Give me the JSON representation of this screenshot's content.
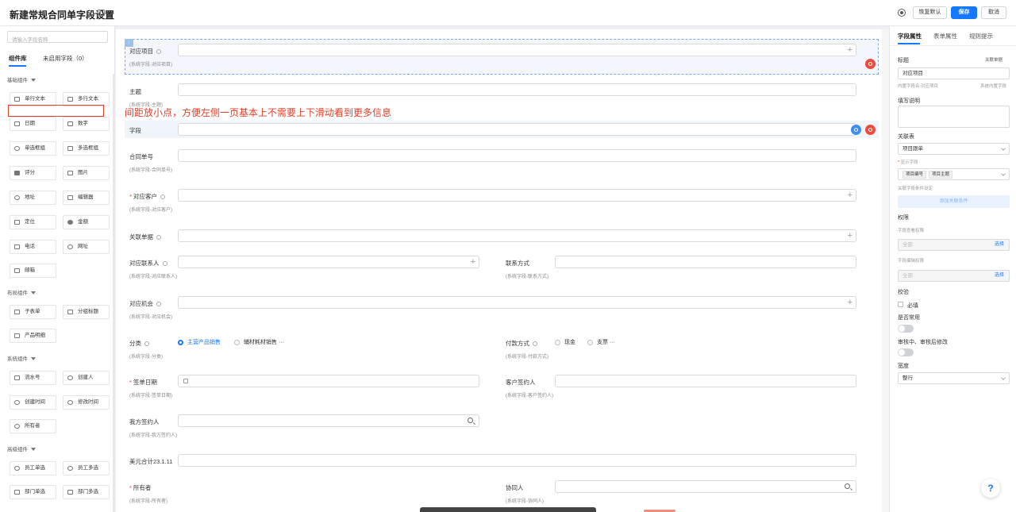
{
  "header": {
    "title": "新建常规合同单字段设置",
    "buttons": {
      "restore": "恢复默认",
      "save": "保存",
      "cancel": "取消"
    }
  },
  "left_panel": {
    "search_placeholder": "请输入字段名称",
    "tabs": [
      "组件库",
      "未启用字段（0）"
    ],
    "sections": {
      "basic": {
        "title": "基础组件",
        "items": [
          "单行文本",
          "多行文本",
          "日期",
          "数字",
          "单选框组",
          "多选框组",
          "评分",
          "图片",
          "地址",
          "编辑器",
          "定位",
          "金额",
          "电话",
          "网址",
          "邮箱"
        ]
      },
      "layout": {
        "title": "布局组件",
        "items": [
          "子表单",
          "分组标题",
          "产品明细"
        ]
      },
      "system": {
        "title": "系统组件",
        "items": [
          "流水号",
          "创建人",
          "创建时间",
          "修改时间",
          "所有者"
        ]
      },
      "advanced": {
        "title": "高级组件",
        "items": [
          "员工单选",
          "员工多选",
          "部门单选",
          "部门多选"
        ]
      }
    }
  },
  "annotation_note": "间距放小点，方便左侧一页基本上不需要上下滑动看到更多信息",
  "form": {
    "f1": {
      "label": "对应项目",
      "sub": "(系统字段-对应项目)"
    },
    "f2": {
      "label": "主题",
      "sub": "(系统字段-主题)"
    },
    "f3": {
      "label": "字段"
    },
    "f4": {
      "label": "合同单号",
      "sub": "(系统字段-合同单号)"
    },
    "f5": {
      "label": "对应客户",
      "sub": "(系统字段-对应客户)"
    },
    "f6": {
      "label": "关联单据"
    },
    "f7": {
      "label": "对应联系人",
      "sub": "(系统字段-对应联系人)"
    },
    "f8": {
      "label": "联系方式",
      "sub": "(系统字段-联系方式)"
    },
    "f9": {
      "label": "对应机会",
      "sub": "(系统字段-对应机会)"
    },
    "f10": {
      "label": "分类",
      "sub": "(系统字段-分类)",
      "options": [
        "主营产品销售",
        "辅材耗材销售"
      ],
      "more": "···"
    },
    "f11": {
      "label": "付款方式",
      "sub": "(系统字段-付款方式)",
      "options": [
        "现金",
        "支票"
      ],
      "more": "···"
    },
    "f12": {
      "label": "签单日期",
      "sub": "(系统字段-签单日期)"
    },
    "f13": {
      "label": "客户签约人",
      "sub": "(系统字段-客户签约人)"
    },
    "f14": {
      "label": "我方签约人",
      "sub": "(系统字段-我方签约人)"
    },
    "f15": {
      "label": "美元合计23.1.11"
    },
    "f16": {
      "label": "所有者",
      "sub": "(系统字段-所有者)"
    },
    "f17": {
      "label": "协同人",
      "sub": "(系统字段-协同人)"
    }
  },
  "right_panel": {
    "tabs": [
      "字段属性",
      "表单属性",
      "规则提示"
    ],
    "title_label": "标题",
    "related_doc": "关联单据",
    "title_value": "对应项目",
    "inner_name": "内置字段名:对应项目",
    "system_inner": "系统内置字段",
    "fill_desc": "填写说明",
    "related_table": "关联表",
    "related_table_value": "项目跟单",
    "display_field": "显示字段",
    "display_tags": [
      "项目编号",
      "项目主题"
    ],
    "related_cond": "关联字段条件设定",
    "add_cond": "添加关联条件",
    "permission": "权限",
    "view_perm": "字段查看权限",
    "all": "全部",
    "select": "选择",
    "edit_perm": "字段编辑权限",
    "validate": "校验",
    "required": "必填",
    "common": "是否常用",
    "audit_modify": "审核中、审核后修改",
    "width": "宽度",
    "width_value": "整行"
  },
  "help": "?"
}
